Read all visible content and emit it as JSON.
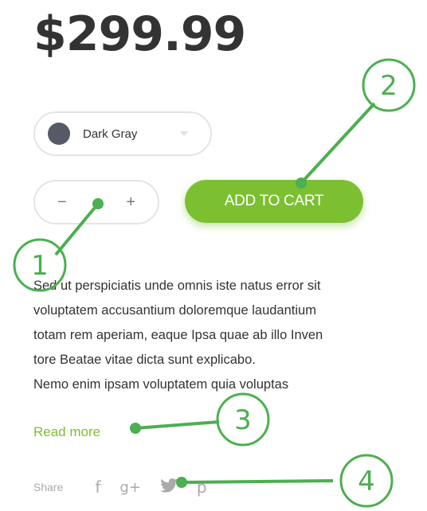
{
  "price": "$299.99",
  "color_select": {
    "label": "Dark Gray",
    "swatch_color": "#555a66"
  },
  "quantity": {
    "minus": "−",
    "plus": "+"
  },
  "add_to_cart": "ADD TO CART",
  "description": {
    "lines": [
      "Sed ut perspiciatis unde omnis iste natus error sit",
      "voluptatem accusantium doloremque laudantium",
      "totam rem aperiam, eaque Ipsa quae ab illo Inven",
      "tore Beatae vitae dicta sunt explicabo.",
      "Nemo enim ipsam voluptatem quia voluptas"
    ]
  },
  "read_more": "Read more",
  "share": {
    "label": "Share",
    "facebook": "f",
    "google_plus": "g+",
    "twitter": "🐦",
    "pinterest": "p"
  },
  "callouts": [
    "1",
    "2",
    "3",
    "4"
  ],
  "colors": {
    "accent": "#7cc032",
    "callout": "#4caf50"
  }
}
